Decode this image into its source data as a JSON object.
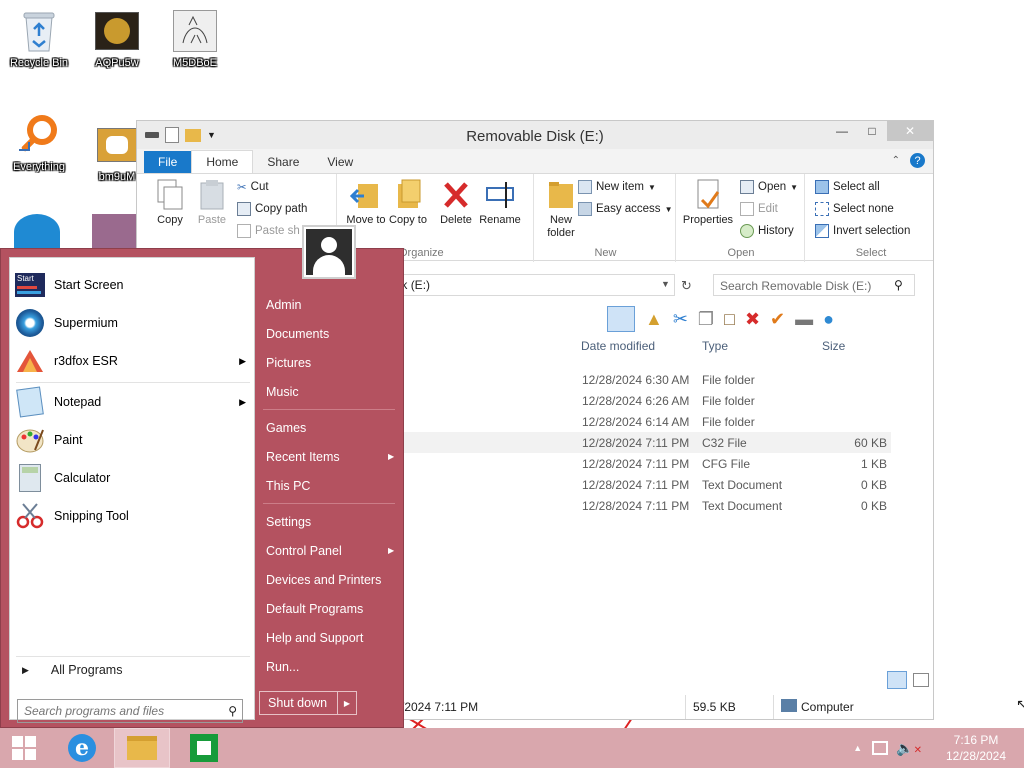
{
  "desktop": {
    "icons": [
      {
        "label": "Recycle Bin",
        "icon": "recycle-bin-icon"
      },
      {
        "label": "AQPu5w",
        "icon": "image-file-icon"
      },
      {
        "label": "M5DBoE",
        "icon": "image-file-icon"
      },
      {
        "label": "Everything",
        "icon": "everything-search-icon"
      },
      {
        "label": "bm9uM",
        "icon": "image-file-icon"
      }
    ]
  },
  "explorer": {
    "title": "Removable Disk (E:)",
    "tabs": [
      "File",
      "Home",
      "Share",
      "View"
    ],
    "ribbon": {
      "clipboard": {
        "copy": "Copy",
        "paste": "Paste",
        "cut": "Cut",
        "copy_path": "Copy path",
        "paste_shortcut": "Paste sh"
      },
      "organize": {
        "move_to": "Move to",
        "copy_to": "Copy to",
        "delete": "Delete",
        "rename": "Rename",
        "group": "Organize"
      },
      "new": {
        "new_folder": "New folder",
        "new_item": "New item",
        "easy_access": "Easy access",
        "group": "New"
      },
      "open": {
        "properties": "Properties",
        "open": "Open",
        "edit": "Edit",
        "history": "History",
        "group": "Open"
      },
      "select": {
        "select_all": "Select all",
        "select_none": "Select none",
        "invert": "Invert selection",
        "group": "Select"
      }
    },
    "address": "vable Disk (E:)",
    "search_placeholder": "Search Removable Disk (E:)",
    "columns": {
      "date": "Date modified",
      "type": "Type",
      "size": "Size"
    },
    "rows": [
      {
        "date": "12/28/2024 6:30 AM",
        "type": "File folder",
        "size": ""
      },
      {
        "date": "12/28/2024 6:26 AM",
        "type": "File folder",
        "size": ""
      },
      {
        "date": "12/28/2024 6:14 AM",
        "type": "File folder",
        "size": ""
      },
      {
        "date": "12/28/2024 7:11 PM",
        "type": "C32 File",
        "size": "60 KB"
      },
      {
        "date": "12/28/2024 7:11 PM",
        "type": "CFG File",
        "size": "1 KB"
      },
      {
        "date": "12/28/2024 7:11 PM",
        "type": "Text Document",
        "size": "0 KB"
      },
      {
        "date": "12/28/2024 7:11 PM",
        "type": "Text Document",
        "size": "0 KB"
      }
    ],
    "status": {
      "date": "/2024 7:11 PM",
      "size": "59.5 KB",
      "location": "Computer"
    }
  },
  "start_menu": {
    "left_items": [
      {
        "label": "Start Screen",
        "icon": "start-screen-icon",
        "arrow": false
      },
      {
        "label": "Supermium",
        "icon": "supermium-icon",
        "arrow": false
      },
      {
        "label": "r3dfox ESR",
        "icon": "r3dfox-icon",
        "arrow": true
      },
      {
        "label": "Notepad",
        "icon": "notepad-icon",
        "arrow": true
      },
      {
        "label": "Paint",
        "icon": "paint-icon",
        "arrow": false
      },
      {
        "label": "Calculator",
        "icon": "calculator-icon",
        "arrow": false
      },
      {
        "label": "Snipping Tool",
        "icon": "snipping-tool-icon",
        "arrow": false
      }
    ],
    "all_programs": "All Programs",
    "search_placeholder": "Search programs and files",
    "right_items": [
      {
        "label": "Admin",
        "arrow": false
      },
      {
        "label": "Documents",
        "arrow": false
      },
      {
        "label": "Pictures",
        "arrow": false
      },
      {
        "label": "Music",
        "arrow": false
      },
      {
        "label": "Games",
        "arrow": false
      },
      {
        "label": "Recent Items",
        "arrow": true
      },
      {
        "label": "This PC",
        "arrow": false
      },
      {
        "label": "Settings",
        "arrow": false
      },
      {
        "label": "Control Panel",
        "arrow": true
      },
      {
        "label": "Devices and Printers",
        "arrow": false
      },
      {
        "label": "Default Programs",
        "arrow": false
      },
      {
        "label": "Help and Support",
        "arrow": false
      },
      {
        "label": "Run...",
        "arrow": false
      }
    ],
    "shutdown": "Shut down"
  },
  "taskbar": {
    "time": "7:16 PM",
    "date": "12/28/2024"
  },
  "colors": {
    "start_menu_bg": "#b45260",
    "taskbar_bg": "#d9a7ad",
    "file_tab": "#1979ca"
  }
}
